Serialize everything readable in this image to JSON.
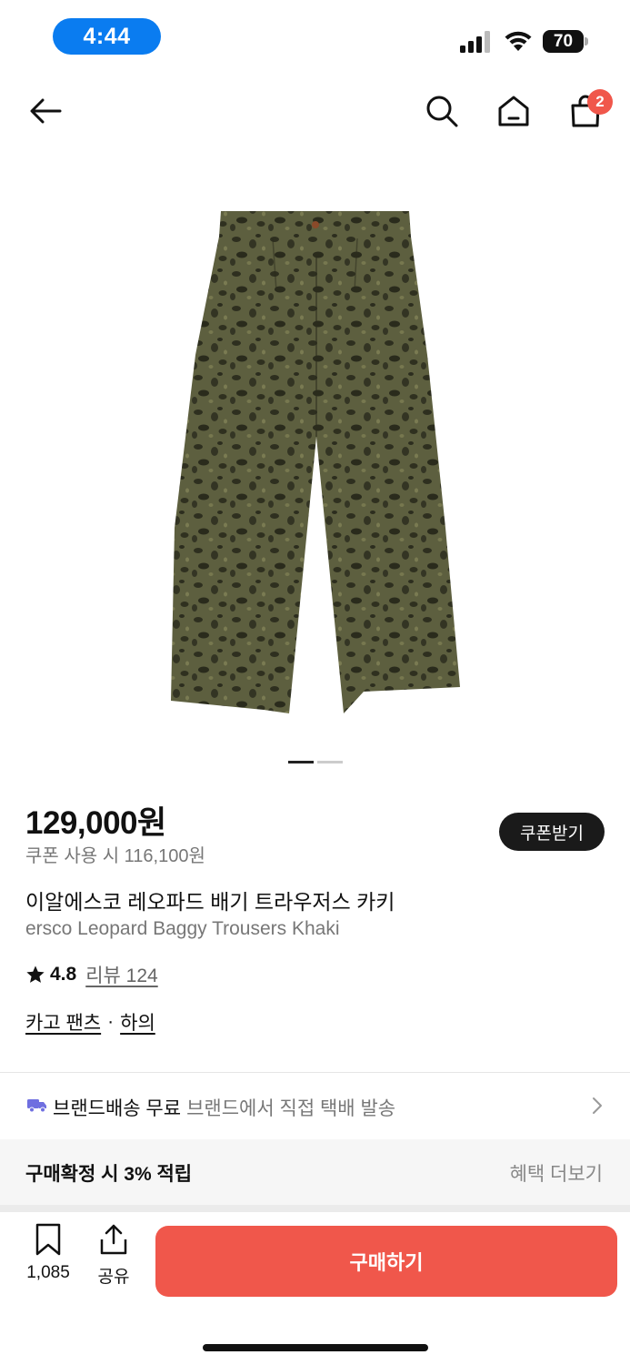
{
  "status_bar": {
    "time": "4:44",
    "battery": "70"
  },
  "header": {
    "cart_count": "2",
    "icons": [
      "back-arrow-icon",
      "search-icon",
      "home-icon",
      "shopping-bag-icon"
    ]
  },
  "gallery": {
    "image_description_icon": "leopard-print-trousers-image",
    "page_count": 2,
    "active_page": 1
  },
  "product": {
    "price": "129,000원",
    "coupon_price": "쿠폰 사용 시 116,100원",
    "coupon_button": "쿠폰받기",
    "name_ko": "이알에스코 레오파드 배기 트라우저스 카키",
    "name_en": "ersco Leopard Baggy Trousers Khaki",
    "rating": "4.8",
    "review_label": "리뷰 124",
    "categories": [
      "카고 팬츠",
      "하의"
    ],
    "category_separator": "·"
  },
  "shipping": {
    "title": "브랜드배송 무료",
    "description": "브랜드에서 직접 택배 발송"
  },
  "benefit": {
    "title": "구매확정 시 3% 적립",
    "more": "혜택 더보기"
  },
  "bottom_bar": {
    "bookmark_count": "1,085",
    "share_label": "공유",
    "buy_label": "구매하기"
  },
  "colors": {
    "accent": "#f0574b",
    "time_pill": "#0a7cf0",
    "truck_icon": "#6f6fe0"
  }
}
